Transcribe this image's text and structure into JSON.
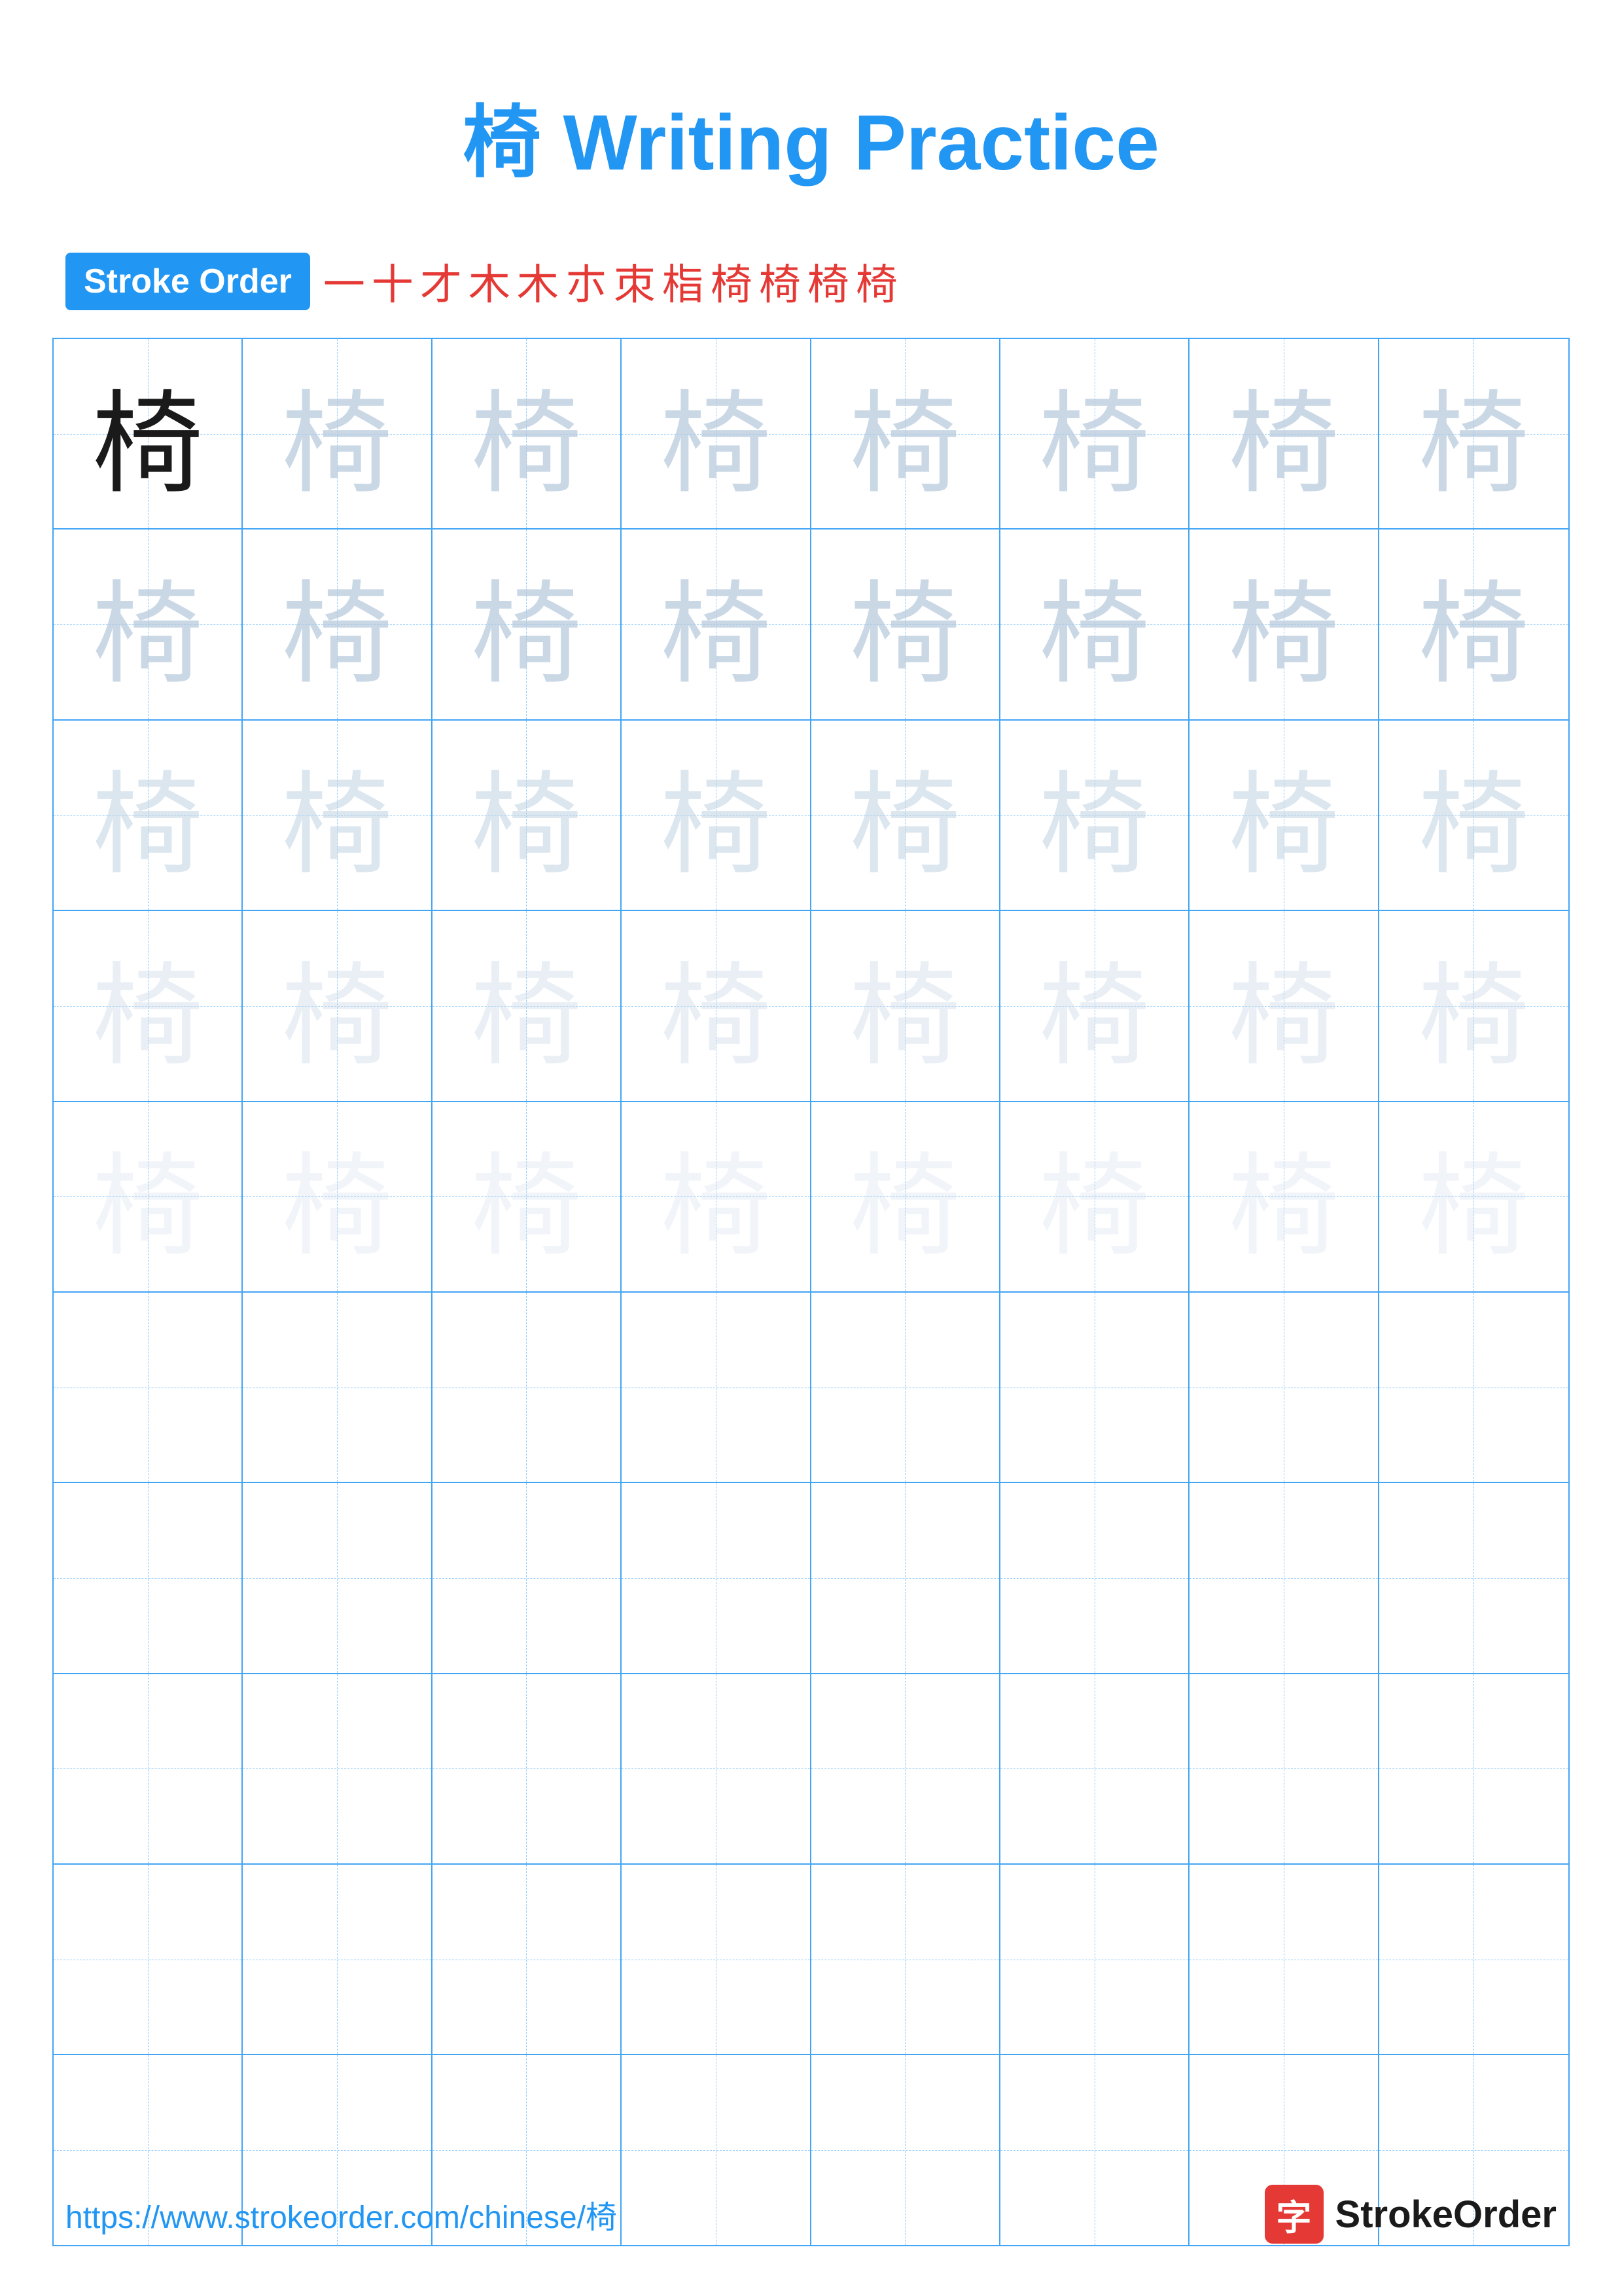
{
  "title": "椅 Writing Practice",
  "stroke_order": {
    "badge_label": "Stroke Order",
    "strokes": [
      "一",
      "十",
      "才",
      "木",
      "木",
      "朩",
      "朿",
      "栺",
      "椅",
      "椅",
      "椅",
      "椅"
    ]
  },
  "character": "椅",
  "grid": {
    "rows": 10,
    "cols": 8
  },
  "footer": {
    "url": "https://www.strokeorder.com/chinese/椅",
    "logo_char": "字",
    "logo_name": "StrokeOrder"
  }
}
